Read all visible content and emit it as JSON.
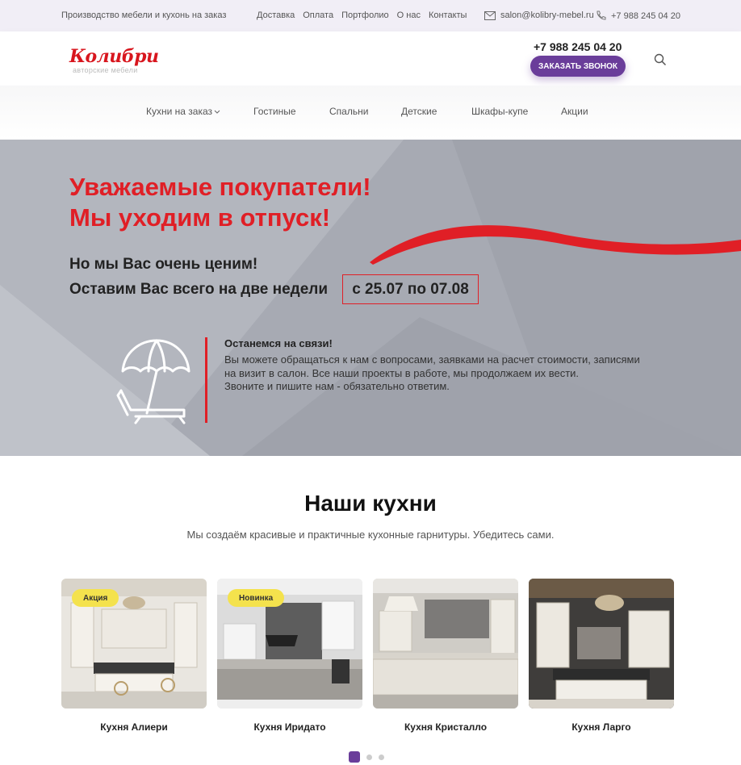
{
  "topbar": {
    "tagline": "Производство мебели и кухонь на заказ",
    "nav": [
      "Доставка",
      "Оплата",
      "Портфолио",
      "О нас",
      "Контакты"
    ],
    "email": "salon@kolibry-mebel.ru",
    "phone": "+7 988 245 04 20"
  },
  "header": {
    "logo_text": "Колибри",
    "logo_sub": "авторские мебели",
    "phone": "+7 988 245 04 20",
    "callback_label": "ЗАКАЗАТЬ ЗВОНОК"
  },
  "menu": {
    "items": [
      "Кухни на заказ",
      "Гостиные",
      "Спальни",
      "Детские",
      "Шкафы-купе",
      "Акции"
    ]
  },
  "banner": {
    "title_line1": "Уважаемые покупатели!",
    "title_line2": "Мы уходим в отпуск!",
    "sub_line1": "Но мы Вас очень ценим!",
    "sub_line2": "Оставим Вас всего на две недели",
    "dates": "с 25.07 по 07.08",
    "contact_title": "Останемся на связи!",
    "contact_text": "Вы можете обращаться к нам с вопросами, заявками на расчет стоимости, записями на визит в салон. Все наши проекты в работе, мы продолжаем их вести.",
    "contact_text2": "Звоните и пишите нам - обязательно ответим."
  },
  "kitchens": {
    "title": "Наши кухни",
    "subtitle": "Мы создаём красивые и практичные кухонные гарнитуры. Убедитесь сами.",
    "cards": [
      {
        "name": "Кухня Алиери",
        "badge": "Акция"
      },
      {
        "name": "Кухня Иридато",
        "badge": "Новинка"
      },
      {
        "name": "Кухня Кристалло",
        "badge": ""
      },
      {
        "name": "Кухня Ларго",
        "badge": ""
      }
    ]
  },
  "colors": {
    "accent": "#6a3d9a",
    "red": "#e01f26",
    "badge": "#f4e24d",
    "banner_bg": "#a7aab3"
  }
}
